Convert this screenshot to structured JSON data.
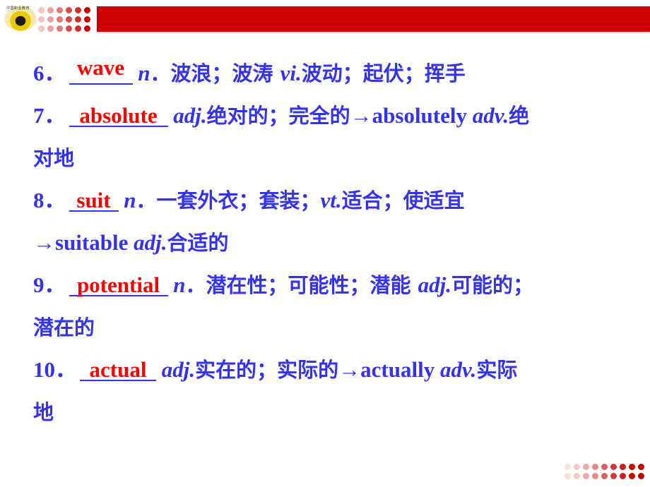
{
  "header": {
    "logo_label": "中国职业教育",
    "top_dots": {
      "rows": 3,
      "cols": 6,
      "colors": [
        "#f4c4c4",
        "#eca0a0",
        "#e07a7a",
        "#d84a4a",
        "#d22a2a",
        "#cc0000"
      ]
    },
    "bar_color": "#cc0000"
  },
  "colors": {
    "text": "#3333ee",
    "answer": "#ff0000"
  },
  "entries": [
    {
      "number": "6．",
      "answer": "wave",
      "lines": [
        [
          {
            "t": " ",
            "style": "plain"
          },
          {
            "t": "n",
            "style": "it"
          },
          {
            "t": "．波浪；波涛 ",
            "style": "cn"
          },
          {
            "t": "vi.",
            "style": "it"
          },
          {
            "t": "波动；起伏；挥手",
            "style": "cn"
          }
        ]
      ]
    },
    {
      "number": "7．",
      "answer": "absolute",
      "lines": [
        [
          {
            "t": " ",
            "style": "plain"
          },
          {
            "t": "adj.",
            "style": "it"
          },
          {
            "t": "绝对的；完全的",
            "style": "cn"
          },
          {
            "t": "→absolutely ",
            "style": "plain"
          },
          {
            "t": "adv.",
            "style": "it"
          },
          {
            "t": "绝",
            "style": "cn"
          }
        ],
        [
          {
            "t": "对地",
            "style": "cn"
          }
        ]
      ]
    },
    {
      "number": "8．",
      "answer": "suit",
      "lines": [
        [
          {
            "t": " ",
            "style": "plain"
          },
          {
            "t": "n",
            "style": "it"
          },
          {
            "t": "．一套外衣；套装；",
            "style": "cn"
          },
          {
            "t": "vt.",
            "style": "it"
          },
          {
            "t": "适合；使适宜",
            "style": "cn"
          }
        ],
        [
          {
            "t": "→suitable ",
            "style": "plain"
          },
          {
            "t": "adj.",
            "style": "it"
          },
          {
            "t": "合适的",
            "style": "cn"
          }
        ]
      ]
    },
    {
      "number": "9．",
      "answer": "potential",
      "lines": [
        [
          {
            "t": " ",
            "style": "plain"
          },
          {
            "t": "n",
            "style": "it"
          },
          {
            "t": "．潜在性；可能性；潜能 ",
            "style": "cn"
          },
          {
            "t": "adj.",
            "style": "it"
          },
          {
            "t": "可能的；",
            "style": "cn"
          }
        ],
        [
          {
            "t": "潜在的",
            "style": "cn"
          }
        ]
      ]
    },
    {
      "number": "10．",
      "answer": "actual",
      "lines": [
        [
          {
            "t": " ",
            "style": "plain"
          },
          {
            "t": "adj.",
            "style": "it"
          },
          {
            "t": "实在的；实际的",
            "style": "cn"
          },
          {
            "t": "→actually ",
            "style": "plain"
          },
          {
            "t": "adv.",
            "style": "it"
          },
          {
            "t": "实际",
            "style": "cn"
          }
        ],
        [
          {
            "t": "地",
            "style": "cn"
          }
        ]
      ]
    }
  ],
  "footer": {
    "bottom_dots": {
      "rows": 2,
      "cols": 9,
      "colors": [
        "#fbe0e0",
        "#f6c8c8",
        "#eea8a8",
        "#e48888",
        "#da6060",
        "#d23a3a",
        "#cc1a1a",
        "#c80606",
        "#c40000"
      ]
    }
  }
}
